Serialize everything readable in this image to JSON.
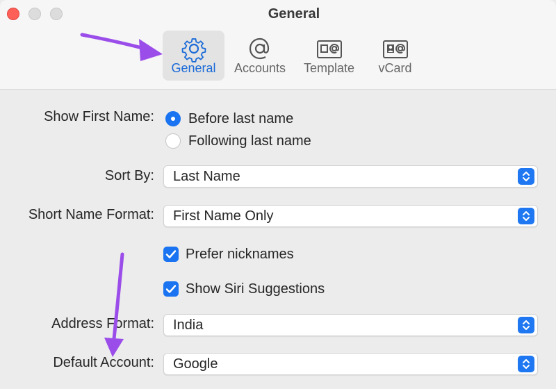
{
  "window": {
    "title": "General"
  },
  "tabs": [
    {
      "label": "General",
      "icon": "gear-icon",
      "active": true
    },
    {
      "label": "Accounts",
      "icon": "at-sign-icon",
      "active": false
    },
    {
      "label": "Template",
      "icon": "template-card-icon",
      "active": false
    },
    {
      "label": "vCard",
      "icon": "vcard-icon",
      "active": false
    }
  ],
  "settings": {
    "show_first_name": {
      "label": "Show First Name:",
      "options": [
        {
          "label": "Before last name",
          "selected": true
        },
        {
          "label": "Following last name",
          "selected": false
        }
      ]
    },
    "sort_by": {
      "label": "Sort By:",
      "value": "Last Name"
    },
    "short_name_format": {
      "label": "Short Name Format:",
      "value": "First Name Only"
    },
    "prefer_nicknames": {
      "label": "Prefer nicknames",
      "checked": true
    },
    "show_siri_suggestions": {
      "label": "Show Siri Suggestions",
      "checked": true
    },
    "address_format": {
      "label": "Address Format:",
      "value": "India"
    },
    "default_account": {
      "label": "Default Account:",
      "value": "Google"
    }
  },
  "colors": {
    "accent": "#1a73f0",
    "annotation_arrow": "#9b4dea",
    "active_tab_text": "#1a6ad8"
  }
}
